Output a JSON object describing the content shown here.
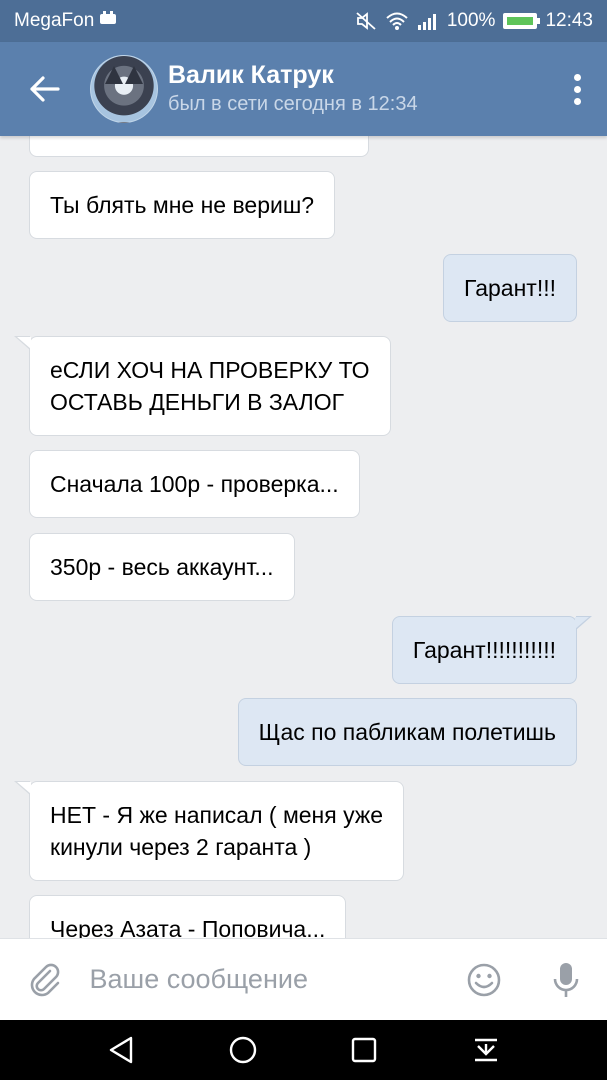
{
  "status_bar": {
    "carrier": "MegaFon",
    "battery_percent": "100%",
    "time": "12:43"
  },
  "header": {
    "contact_name": "Валик Катрук",
    "contact_status": "был в сети сегодня в 12:34"
  },
  "messages": [
    {
      "direction": "in",
      "text": "Ты блять мне не вериш?"
    },
    {
      "direction": "out",
      "text": "Гарант!!!"
    },
    {
      "direction": "in",
      "lines": [
        "еСЛИ ХОЧ НА ПРОВЕРКУ ТО",
        "ОСТАВЬ ДЕНЬГИ В ЗАЛОГ"
      ]
    },
    {
      "direction": "in",
      "text": "Сначала 100р - проверка..."
    },
    {
      "direction": "in",
      "text": "350р - весь аккаунт..."
    },
    {
      "direction": "out",
      "text": "Гарант!!!!!!!!!!!"
    },
    {
      "direction": "out",
      "text": "Щас по пабликам полетишь"
    },
    {
      "direction": "in",
      "lines": [
        "НЕТ - Я же написал ( меня уже",
        "кинули через 2 гаранта )"
      ]
    },
    {
      "direction": "in",
      "text": "Через Азата - Поповича..."
    }
  ],
  "input": {
    "placeholder": "Ваше сообщение"
  },
  "icons": {
    "back": "arrow-left-icon",
    "menu": "more-vertical-icon",
    "attach": "paperclip-icon",
    "emoji": "smiley-icon",
    "mic": "microphone-icon",
    "nav_back": "triangle-back-icon",
    "nav_home": "circle-home-icon",
    "nav_recent": "square-recent-icon",
    "nav_notifications": "pull-down-icon"
  },
  "colors": {
    "header": "#5b80ad",
    "status_bar": "#4d6e96",
    "incoming_bubble": "#ffffff",
    "outgoing_bubble": "#dde7f3",
    "chat_background": "#edeef0"
  }
}
